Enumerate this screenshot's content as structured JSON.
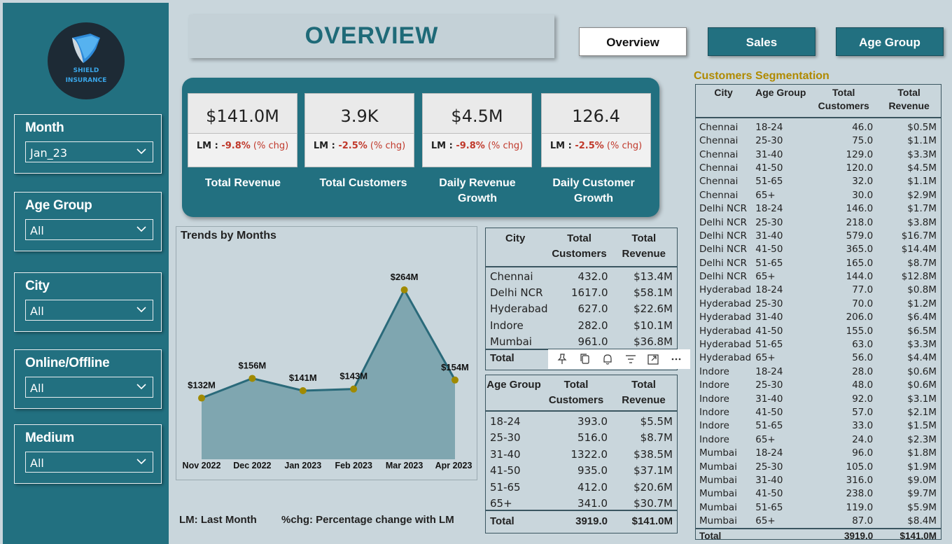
{
  "logo": {
    "line1": "SHIELD",
    "line2": "INSURANCE"
  },
  "filters": [
    {
      "label": "Month",
      "value": "Jan_23"
    },
    {
      "label": "Age Group",
      "value": "All"
    },
    {
      "label": "City",
      "value": "All"
    },
    {
      "label": "Online/Offline",
      "value": "All"
    },
    {
      "label": "Medium",
      "value": "All"
    }
  ],
  "page_title": "OVERVIEW",
  "nav": [
    {
      "label": "Overview",
      "active": true
    },
    {
      "label": "Sales",
      "active": false
    },
    {
      "label": "Age Group",
      "active": false
    }
  ],
  "kpis": [
    {
      "value": "$141.0M",
      "lm_prefix": "LM : ",
      "lm_change": "-9.8%",
      "lm_suffix": " (% chg)",
      "name": "Total Revenue"
    },
    {
      "value": "3.9K",
      "lm_prefix": "LM : ",
      "lm_change": "-2.5%",
      "lm_suffix": " (% chg)",
      "name": "Total Customers"
    },
    {
      "value": "$4.5M",
      "lm_prefix": "LM : ",
      "lm_change": "-9.8%",
      "lm_suffix": " (% chg)",
      "name": "Daily Revenue Growth"
    },
    {
      "value": "126.4",
      "lm_prefix": "LM : ",
      "lm_change": "-2.5%",
      "lm_suffix": " (% chg)",
      "name": "Daily Customer Growth"
    }
  ],
  "trend": {
    "title": "Trends by Months"
  },
  "chart_data": {
    "type": "area",
    "title": "Trends by Months",
    "categories": [
      "Nov 2022",
      "Dec 2022",
      "Jan 2023",
      "Feb 2023",
      "Mar 2023",
      "Apr 2023"
    ],
    "values": [
      132,
      156,
      141,
      143,
      264,
      154
    ],
    "data_labels": [
      "$132M",
      "$156M",
      "$141M",
      "$143M",
      "$264M",
      "$154M"
    ],
    "unit": "$M",
    "colors": {
      "area": "#7fa6b0",
      "line": "#2a6a7a",
      "marker": "#a08a00"
    },
    "grid": false
  },
  "notes": {
    "lm": "LM: Last Month",
    "chg": "%chg: Percentage change with LM"
  },
  "city_table": {
    "headers": [
      "City",
      "Total Customers",
      "Total Revenue"
    ],
    "rows": [
      [
        "Chennai",
        "432.0",
        "$13.4M"
      ],
      [
        "Delhi NCR",
        "1617.0",
        "$58.1M"
      ],
      [
        "Hyderabad",
        "627.0",
        "$22.6M"
      ],
      [
        "Indore",
        "282.0",
        "$10.1M"
      ],
      [
        "Mumbai",
        "961.0",
        "$36.8M"
      ]
    ],
    "total_label": "Total",
    "total_customers": "3919.0",
    "total_revenue": "$141.0M"
  },
  "age_table": {
    "headers": [
      "Age Group",
      "Total Customers",
      "Total Revenue"
    ],
    "rows": [
      [
        "18-24",
        "393.0",
        "$5.5M"
      ],
      [
        "25-30",
        "516.0",
        "$8.7M"
      ],
      [
        "31-40",
        "1322.0",
        "$38.5M"
      ],
      [
        "41-50",
        "935.0",
        "$37.1M"
      ],
      [
        "51-65",
        "412.0",
        "$20.6M"
      ],
      [
        "65+",
        "341.0",
        "$30.7M"
      ]
    ],
    "total_label": "Total",
    "total_customers": "3919.0",
    "total_revenue": "$141.0M"
  },
  "segmentation": {
    "title": "Customers Segmentation",
    "headers": [
      "City",
      "Age Group",
      "Total Customers",
      "Total Revenue"
    ],
    "rows": [
      [
        "Chennai",
        "18-24",
        "46.0",
        "$0.5M"
      ],
      [
        "Chennai",
        "25-30",
        "75.0",
        "$1.1M"
      ],
      [
        "Chennai",
        "31-40",
        "129.0",
        "$3.3M"
      ],
      [
        "Chennai",
        "41-50",
        "120.0",
        "$4.5M"
      ],
      [
        "Chennai",
        "51-65",
        "32.0",
        "$1.1M"
      ],
      [
        "Chennai",
        "65+",
        "30.0",
        "$2.9M"
      ],
      [
        "Delhi NCR",
        "18-24",
        "146.0",
        "$1.7M"
      ],
      [
        "Delhi NCR",
        "25-30",
        "218.0",
        "$3.8M"
      ],
      [
        "Delhi NCR",
        "31-40",
        "579.0",
        "$16.7M"
      ],
      [
        "Delhi NCR",
        "41-50",
        "365.0",
        "$14.4M"
      ],
      [
        "Delhi NCR",
        "51-65",
        "165.0",
        "$8.7M"
      ],
      [
        "Delhi NCR",
        "65+",
        "144.0",
        "$12.8M"
      ],
      [
        "Hyderabad",
        "18-24",
        "77.0",
        "$0.8M"
      ],
      [
        "Hyderabad",
        "25-30",
        "70.0",
        "$1.2M"
      ],
      [
        "Hyderabad",
        "31-40",
        "206.0",
        "$6.4M"
      ],
      [
        "Hyderabad",
        "41-50",
        "155.0",
        "$6.5M"
      ],
      [
        "Hyderabad",
        "51-65",
        "63.0",
        "$3.3M"
      ],
      [
        "Hyderabad",
        "65+",
        "56.0",
        "$4.4M"
      ],
      [
        "Indore",
        "18-24",
        "28.0",
        "$0.6M"
      ],
      [
        "Indore",
        "25-30",
        "48.0",
        "$0.6M"
      ],
      [
        "Indore",
        "31-40",
        "92.0",
        "$3.1M"
      ],
      [
        "Indore",
        "41-50",
        "57.0",
        "$2.1M"
      ],
      [
        "Indore",
        "51-65",
        "33.0",
        "$1.5M"
      ],
      [
        "Indore",
        "65+",
        "24.0",
        "$2.3M"
      ],
      [
        "Mumbai",
        "18-24",
        "96.0",
        "$1.8M"
      ],
      [
        "Mumbai",
        "25-30",
        "105.0",
        "$1.9M"
      ],
      [
        "Mumbai",
        "31-40",
        "316.0",
        "$9.0M"
      ],
      [
        "Mumbai",
        "41-50",
        "238.0",
        "$9.7M"
      ],
      [
        "Mumbai",
        "51-65",
        "119.0",
        "$5.9M"
      ],
      [
        "Mumbai",
        "65+",
        "87.0",
        "$8.4M"
      ]
    ],
    "total_label": "Total",
    "total_customers": "3919.0",
    "total_revenue": "$141.0M"
  },
  "toolbar_icons": [
    "pin-icon",
    "copy-icon",
    "bell-icon",
    "filter-icon",
    "focus-mode-icon",
    "more-options-icon"
  ],
  "colors": {
    "teal": "#227080",
    "background": "#c9d6dc",
    "negative": "#c0392b",
    "segmentation_title": "#b08a00"
  }
}
